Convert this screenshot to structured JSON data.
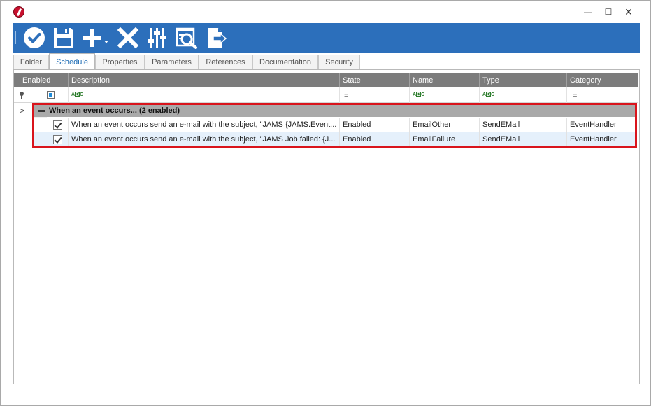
{
  "window": {
    "controls": {
      "minimize": "—",
      "maximize": "☐",
      "close": "✕"
    }
  },
  "toolbar": {
    "buttons": [
      {
        "name": "ok",
        "icon": "check-circle-icon"
      },
      {
        "name": "save",
        "icon": "floppy-disk-icon"
      },
      {
        "name": "add",
        "icon": "plus-dropdown-icon"
      },
      {
        "name": "delete",
        "icon": "x-icon"
      },
      {
        "name": "properties",
        "icon": "sliders-icon"
      },
      {
        "name": "view",
        "icon": "magnify-document-icon"
      },
      {
        "name": "export",
        "icon": "document-export-icon"
      }
    ],
    "color": "#2c6fbb"
  },
  "tabs": [
    {
      "label": "Folder",
      "active": false
    },
    {
      "label": "Schedule",
      "active": true
    },
    {
      "label": "Properties",
      "active": false
    },
    {
      "label": "Parameters",
      "active": false
    },
    {
      "label": "References",
      "active": false
    },
    {
      "label": "Documentation",
      "active": false
    },
    {
      "label": "Security",
      "active": false
    }
  ],
  "grid": {
    "columns": [
      "Enabled",
      "Description",
      "State",
      "Name",
      "Type",
      "Category"
    ],
    "group": {
      "label": "When an event occurs... (2 enabled)",
      "expander": ">"
    },
    "rows": [
      {
        "enabled": true,
        "description": "When an event occurs send an e-mail with the subject, \"JAMS {JAMS.Event...",
        "state": "Enabled",
        "name": "EmailOther",
        "type": "SendEMail",
        "category": "EventHandler"
      },
      {
        "enabled": true,
        "description": "When an event occurs send an e-mail with the subject, \"JAMS Job failed: {J...",
        "state": "Enabled",
        "name": "EmailFailure",
        "type": "SendEMail",
        "category": "EventHandler"
      }
    ],
    "filter_symbols": {
      "text": "ABC",
      "equals": "="
    },
    "highlight_color": "#d9141c",
    "selected_row_color": "#e5f0fb"
  }
}
